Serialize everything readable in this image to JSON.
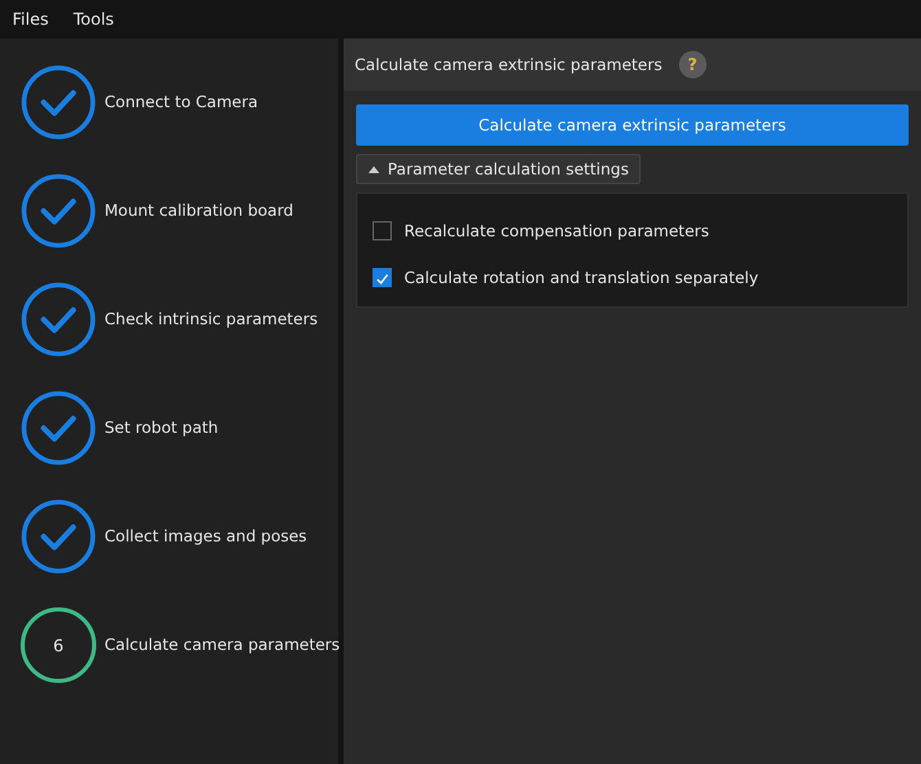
{
  "menu": [
    "Files",
    "Tools"
  ],
  "steps": [
    {
      "kind": "done",
      "label": "Connect to Camera"
    },
    {
      "kind": "done",
      "label": "Mount calibration board"
    },
    {
      "kind": "done",
      "label": "Check intrinsic parameters"
    },
    {
      "kind": "done",
      "label": "Set robot path"
    },
    {
      "kind": "done",
      "label": "Collect images and poses"
    },
    {
      "kind": "current",
      "number": "6",
      "label": "Calculate camera parameters"
    }
  ],
  "panel": {
    "title": "Calculate camera extrinsic parameters",
    "help": "?",
    "action_button": "Calculate camera extrinsic parameters",
    "settings": {
      "label": "Parameter calculation settings",
      "expanded": true,
      "options": [
        {
          "label": "Recalculate compensation parameters",
          "checked": false
        },
        {
          "label": "Calculate rotation and translation separately",
          "checked": true
        }
      ]
    }
  }
}
